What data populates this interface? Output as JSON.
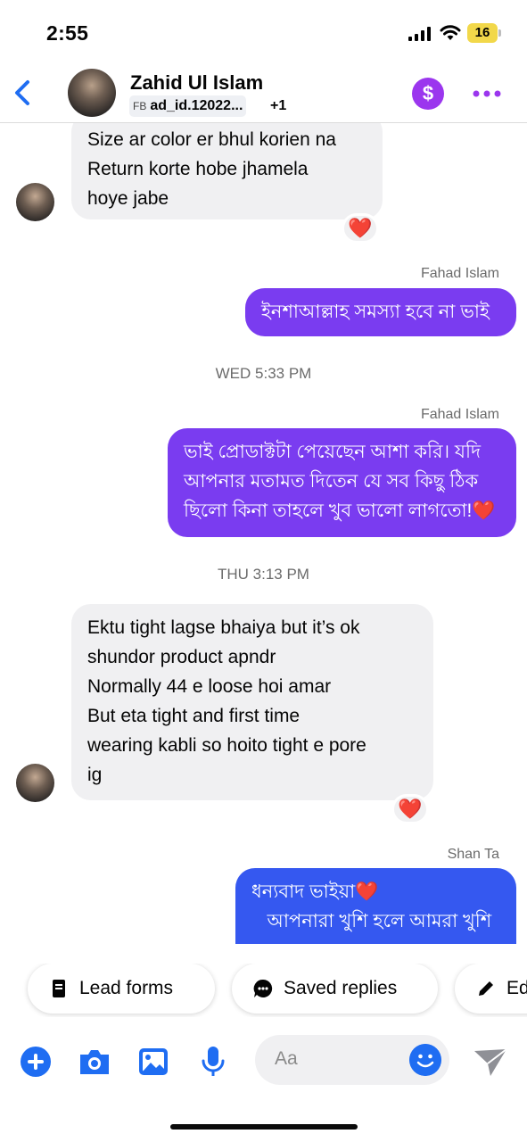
{
  "status_bar": {
    "time": "2:55",
    "battery": "16"
  },
  "header": {
    "contact_name": "Zahid Ul Islam",
    "ad_prefix": "FB",
    "ad_id": "ad_id.12022...",
    "participants_extra": "+1",
    "payment_symbol": "$"
  },
  "messages": {
    "m1": {
      "lines": [
        "Size ar color er bhul korien na",
        "Return korte hobe jhamela",
        "hoye jabe"
      ],
      "reaction": "❤️"
    },
    "m2": {
      "sender": "Fahad Islam",
      "text": "ইনশাআল্লাহ সমস্যা হবে না ভাই"
    },
    "ts1": "WED 5:33 PM",
    "m3": {
      "sender": "Fahad Islam",
      "lines": [
        "ভাই প্রোডাক্টটা পেয়েছেন আশা করি। যদি",
        "আপনার মতামত দিতেন যে সব কিছু ঠিক",
        "ছিলো কিনা তাহলে খুব ভালো লাগতো!❤️"
      ]
    },
    "ts2": "THU 3:13 PM",
    "m4": {
      "lines": [
        "Ektu tight lagse bhaiya but it’s ok",
        "shundor product apndr",
        "Normally 44 e loose hoi amar",
        "But eta tight and first time",
        "wearing kabli so hoito tight e pore",
        "ig"
      ],
      "reaction": "❤️"
    },
    "m5": {
      "sender": "Shan Ta",
      "lines": [
        "ধন্যবাদ ভাইয়া❤️",
        "   আপনারা খুশি হলে আমরা খুশি"
      ]
    }
  },
  "quick_replies": {
    "lead_forms": "Lead forms",
    "saved_replies": "Saved replies",
    "edit": "Ed"
  },
  "composer": {
    "placeholder": "Aa"
  },
  "colors": {
    "accent_purple": "#7a3cf0",
    "accent_blue": "#3558f0",
    "icon_blue": "#1f6df2",
    "payment_purple": "#9b36ee"
  }
}
